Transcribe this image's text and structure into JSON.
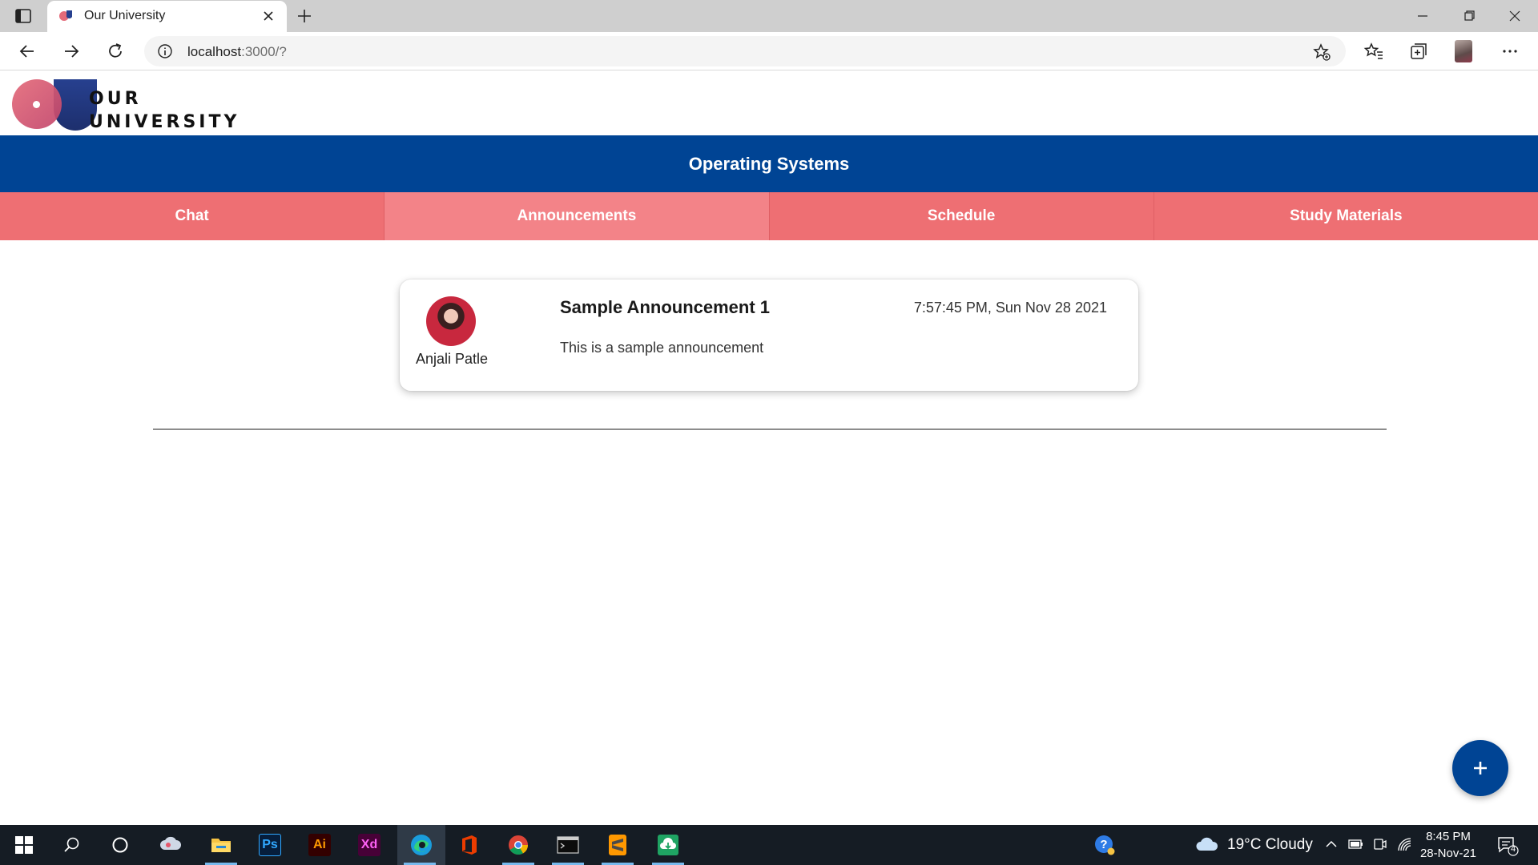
{
  "browser": {
    "tab_title": "Our University",
    "url_host": "localhost",
    "url_rest": ":3000/?"
  },
  "logo": {
    "line1": "OUR",
    "line2": "UNIVERSITY"
  },
  "course": {
    "title": "Operating Systems"
  },
  "nav_tabs": [
    {
      "label": "Chat",
      "active": false
    },
    {
      "label": "Announcements",
      "active": true
    },
    {
      "label": "Schedule",
      "active": false
    },
    {
      "label": "Study Materials",
      "active": false
    }
  ],
  "announcement": {
    "author": "Anjali Patle",
    "title": "Sample Announcement 1",
    "time": "7:57:45 PM, Sun Nov 28 2021",
    "body": "This is a sample announcement"
  },
  "fab": {
    "icon": "plus-icon"
  },
  "taskbar": {
    "weather": "19°C  Cloudy",
    "time": "8:45 PM",
    "date": "28-Nov-21",
    "notification_count": "4",
    "apps": [
      "start-icon",
      "search-icon",
      "cortana-icon",
      "cloud-app-icon",
      "file-explorer-icon",
      "photoshop-icon",
      "illustrator-icon",
      "xd-icon",
      "edge-icon",
      "office-icon",
      "chrome-icon",
      "terminal-icon",
      "sublime-icon",
      "cloud-download-icon"
    ]
  },
  "colors": {
    "primary_blue": "#004494",
    "tab_coral": "#ee6f73",
    "tab_active": "#f38388"
  }
}
